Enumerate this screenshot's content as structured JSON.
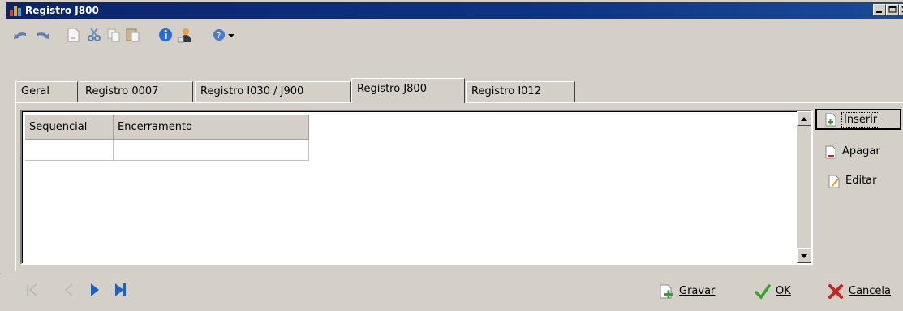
{
  "window": {
    "title": "Registro J800",
    "controls": [
      "minimize",
      "maximize",
      "close"
    ]
  },
  "toolbar": {
    "icons": [
      "undo-icon",
      "redo-icon",
      "new-document-icon",
      "cut-icon",
      "copy-icon",
      "paste-icon",
      "info-icon",
      "user-icon",
      "help-icon",
      "dropdown-icon"
    ]
  },
  "tabs": [
    {
      "label": "Geral",
      "active": false
    },
    {
      "label": "Registro 0007",
      "active": false
    },
    {
      "label": "Registro I030 / J900",
      "active": false
    },
    {
      "label": "Registro J800",
      "active": true
    },
    {
      "label": "Registro I012",
      "active": false
    }
  ],
  "grid": {
    "columns": [
      "Sequencial",
      "Encerramento"
    ],
    "rows": [
      [
        "",
        ""
      ]
    ]
  },
  "side_buttons": {
    "insert": "Inserir",
    "delete": "Apagar",
    "edit": "Editar"
  },
  "bottom": {
    "save": "Gravar",
    "ok": "OK",
    "cancel": "Cancela"
  },
  "colors": {
    "title_bar": "#0a246a",
    "face": "#d4d0c8",
    "nav_active": "#2060c0",
    "ok_green": "#3aa02a",
    "cancel_red": "#d02020"
  }
}
